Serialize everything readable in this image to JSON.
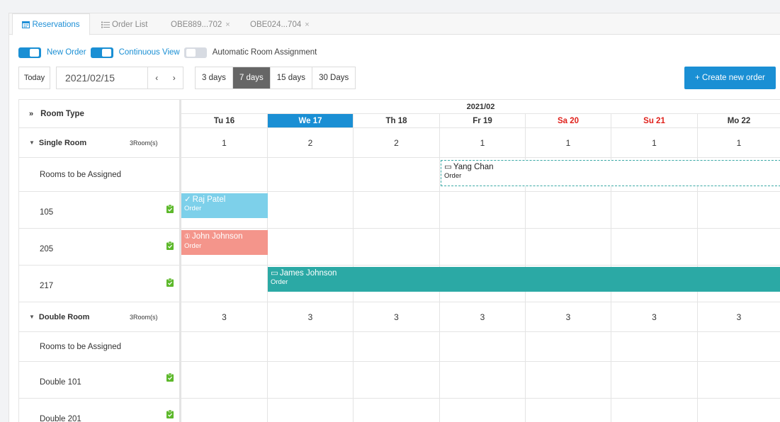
{
  "tabs": [
    {
      "label": "Reservations",
      "icon": "calendar-icon",
      "active": true
    },
    {
      "label": "Order List",
      "icon": "list-icon",
      "active": false
    },
    {
      "label": "OBE889...702",
      "closable": true
    },
    {
      "label": "OBE024...704",
      "closable": true
    }
  ],
  "toggles": {
    "new_order": "New Order",
    "continuous_view": "Continuous View",
    "auto_assign": "Automatic Room Assignment"
  },
  "controls": {
    "today": "Today",
    "date": "2021/02/15",
    "prev": "‹",
    "next": "›",
    "ranges": [
      "3 days",
      "7 days",
      "15 days",
      "30 Days"
    ],
    "selected_range": "7 days",
    "create": "+ Create new order"
  },
  "calendar": {
    "room_type_header": "Room Type",
    "month": "2021/02",
    "days": [
      {
        "label": "Tu 16",
        "type": "normal"
      },
      {
        "label": "We 17",
        "type": "today"
      },
      {
        "label": "Th 18",
        "type": "normal"
      },
      {
        "label": "Fr 19",
        "type": "normal"
      },
      {
        "label": "Sa 20",
        "type": "weekend"
      },
      {
        "label": "Su 21",
        "type": "weekend"
      },
      {
        "label": "Mo 22",
        "type": "normal"
      }
    ],
    "single": {
      "name": "Single Room",
      "count": "3Room(s)",
      "availability": [
        "1",
        "2",
        "2",
        "1",
        "1",
        "1",
        "1"
      ],
      "unassigned": "Rooms to be Assigned",
      "rooms": [
        "105",
        "205",
        "217"
      ]
    },
    "double": {
      "name": "Double Room",
      "count": "3Room(s)",
      "availability": [
        "3",
        "3",
        "3",
        "3",
        "3",
        "3",
        "3"
      ],
      "unassigned": "Rooms to be Assigned",
      "rooms": [
        "Double 101",
        "Double 201"
      ]
    },
    "reservations": {
      "yang": {
        "name": "Yang Chan",
        "label": "Order"
      },
      "raj": {
        "name": "Raj Patel",
        "label": "Order"
      },
      "john": {
        "name": "John Johnson",
        "label": "Order"
      },
      "james": {
        "name": "James Johnson",
        "label": "Order"
      }
    }
  },
  "colors": {
    "accent": "#1a8fd4",
    "weekend": "#e0211b",
    "checked_in": "#7dd0ea",
    "alert": "#f4958b",
    "stay": "#2ba9a5",
    "clean": "#5cb82a"
  }
}
